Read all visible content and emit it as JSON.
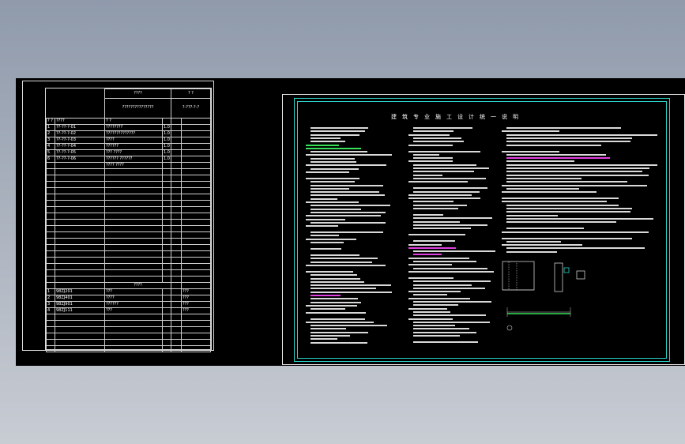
{
  "drawing": {
    "left_sheet": {
      "header_title": "????",
      "header_right": "?  ?",
      "project_label": "???????????????",
      "project_line2": "?  ?",
      "drawing_no": "?-???-?-?",
      "rows": [
        {
          "n": "1",
          "code": "??-??-?-01",
          "name": "????????",
          "v": "1.0"
        },
        {
          "n": "2",
          "code": "??-??-?-02",
          "name": "??????????????",
          "v": "1.0"
        },
        {
          "n": "3",
          "code": "??-??-?-03",
          "name": "????",
          "v": "1.0"
        },
        {
          "n": "4",
          "code": "??-??-?-04",
          "name": "??????",
          "v": "1.0"
        },
        {
          "n": "5",
          "code": "??-??-?-05",
          "name": "??? ????",
          "v": "1.0"
        },
        {
          "n": "6",
          "code": "??-??-?-06",
          "name": "?????? ??????",
          "v": "1.0"
        },
        {
          "n": "",
          "code": "",
          "name": "???? ????",
          "v": ""
        }
      ],
      "std_title": "????",
      "std_rows": [
        {
          "n": "1",
          "code": "98ZJ201",
          "name": "???",
          "v": "???"
        },
        {
          "n": "2",
          "code": "98ZJ401",
          "name": "????",
          "v": "???"
        },
        {
          "n": "3",
          "code": "98ZJ901",
          "name": "??????",
          "v": "???"
        },
        {
          "n": "4",
          "code": "98ZJ111",
          "name": "???",
          "v": "???"
        }
      ]
    },
    "right_sheet": {
      "title": "建筑专业施工设计统一说明"
    }
  }
}
